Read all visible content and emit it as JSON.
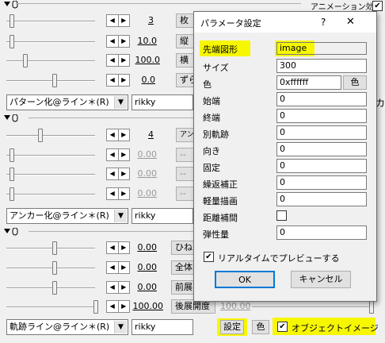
{
  "top_bar": {
    "anim_label": "アニメーション効果",
    "anim_checked": "✔"
  },
  "section1": {
    "rows": [
      {
        "value": "3",
        "button": "枚"
      },
      {
        "value": "10.0",
        "button": "縦"
      },
      {
        "value": "100.0",
        "button": "横"
      },
      {
        "value": "0.0",
        "button": "ずら"
      }
    ],
    "combo_effect": "パターン化@ライン＊(R)",
    "combo_author": "rikky",
    "extra_label": "カ"
  },
  "section2": {
    "rows": [
      {
        "value": "4",
        "button": "アンカ"
      },
      {
        "value": "0.00",
        "button": "--"
      },
      {
        "value": "0.00",
        "button": "--"
      },
      {
        "value": "0.00",
        "button": "--"
      }
    ],
    "combo_effect": "アンカー化@ライン＊(R)",
    "combo_author": "rikky"
  },
  "section3": {
    "rows": [
      {
        "value": "0.00",
        "button": "ひね"
      },
      {
        "value": "0.00",
        "button": "全体"
      },
      {
        "value": "0.00",
        "button": "前展"
      },
      {
        "value": "100.00",
        "button": "後展開度",
        "value_right": "100.00"
      }
    ],
    "combo_effect": "軌跡ライン@ライン＊(R)",
    "combo_author": "rikky",
    "settings_button": "設定",
    "color_button": "色",
    "object_image_label": "オブジェクトイメージ",
    "object_image_checked": "✔"
  },
  "dialog": {
    "title": "パラメータ設定",
    "help": "?",
    "close": "✕",
    "params": [
      {
        "label": "先端図形",
        "value": "image"
      },
      {
        "label": "サイズ",
        "value": "300"
      },
      {
        "label": "色",
        "value": "0xffffff"
      },
      {
        "label": "始端",
        "value": "0"
      },
      {
        "label": "終端",
        "value": "0"
      },
      {
        "label": "別軌跡",
        "value": "0"
      },
      {
        "label": "向き",
        "value": "0"
      },
      {
        "label": "固定",
        "value": "0"
      },
      {
        "label": "繰返補正",
        "value": "0"
      },
      {
        "label": "軽量描画",
        "value": "0"
      },
      {
        "label": "距離補間",
        "value": ""
      },
      {
        "label": "弾性量",
        "value": "0"
      }
    ],
    "color_button": "色",
    "realtime_label": "リアルタイムでプレビューする",
    "realtime_checked": "✔",
    "ok": "OK",
    "cancel": "キャンセル"
  }
}
